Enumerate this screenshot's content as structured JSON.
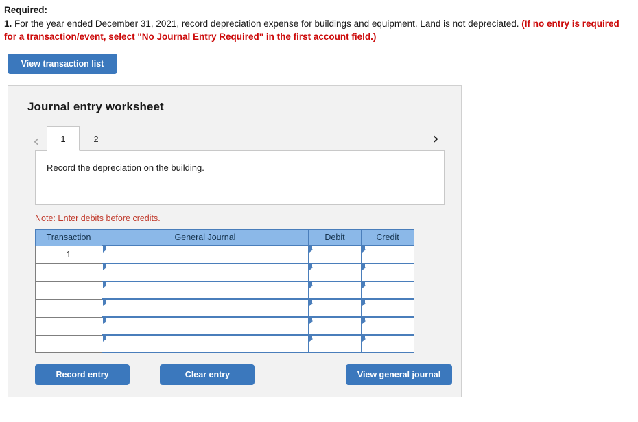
{
  "question": {
    "required_label": "Required:",
    "number": "1.",
    "body": " For the year ended December 31, 2021, record depreciation expense for buildings and equipment. Land is not depreciated. ",
    "red_note": "(If no entry is required for a transaction/event, select \"No Journal Entry Required\" in the first account field.)"
  },
  "toolbar": {
    "view_transaction_list": "View transaction list"
  },
  "worksheet": {
    "title": "Journal entry worksheet",
    "prev_icon": "‹",
    "next_icon": "›",
    "tabs": [
      {
        "label": "1",
        "active": true
      },
      {
        "label": "2",
        "active": false
      }
    ],
    "description": "Record the depreciation on the building.",
    "note": "Note: Enter debits before credits."
  },
  "table": {
    "headers": [
      "Transaction",
      "General Journal",
      "Debit",
      "Credit"
    ],
    "rows": [
      {
        "transaction": "1",
        "general_journal": "",
        "debit": "",
        "credit": ""
      },
      {
        "transaction": "",
        "general_journal": "",
        "debit": "",
        "credit": ""
      },
      {
        "transaction": "",
        "general_journal": "",
        "debit": "",
        "credit": ""
      },
      {
        "transaction": "",
        "general_journal": "",
        "debit": "",
        "credit": ""
      },
      {
        "transaction": "",
        "general_journal": "",
        "debit": "",
        "credit": ""
      },
      {
        "transaction": "",
        "general_journal": "",
        "debit": "",
        "credit": ""
      }
    ]
  },
  "actions": {
    "record_entry": "Record entry",
    "clear_entry": "Clear entry",
    "view_general_journal": "View general journal"
  },
  "colors": {
    "button_blue": "#3b78bd",
    "header_blue": "#8bb8e8",
    "cell_border_blue": "#4a7ebb",
    "note_red": "#c0392b",
    "question_red": "#cc0a0a",
    "panel_gray": "#f2f2f2"
  }
}
